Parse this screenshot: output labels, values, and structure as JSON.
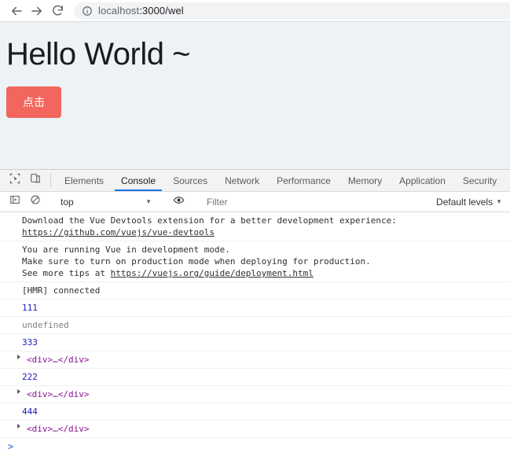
{
  "browser": {
    "back_icon": "arrow-left-icon",
    "forward_icon": "arrow-right-icon",
    "reload_icon": "reload-icon",
    "info_icon": "info-circle-icon",
    "url_host": "localhost",
    "url_rest": ":3000/wel",
    "url_full": "localhost:3000/wel"
  },
  "page": {
    "title": "Hello World ~",
    "button_label": "点击",
    "button_color": "#f3665e",
    "background_color": "#ecf2f6"
  },
  "devtools": {
    "toolbar_icons": [
      {
        "name": "inspect-element-icon"
      },
      {
        "name": "device-toolbar-icon"
      }
    ],
    "tabs": [
      {
        "label": "Elements",
        "active": false
      },
      {
        "label": "Console",
        "active": true
      },
      {
        "label": "Sources",
        "active": false
      },
      {
        "label": "Network",
        "active": false
      },
      {
        "label": "Performance",
        "active": false
      },
      {
        "label": "Memory",
        "active": false
      },
      {
        "label": "Application",
        "active": false
      },
      {
        "label": "Security",
        "active": false
      }
    ],
    "active_tab_underline_color": "#1a73e8",
    "console_toolbar": {
      "sidebar_toggle_icon": "console-sidebar-icon",
      "clear_icon": "clear-console-icon",
      "context_value": "top",
      "eye_icon": "live-expression-eye-icon",
      "filter_placeholder": "Filter",
      "levels_label": "Default levels",
      "caret": "▼"
    },
    "messages": [
      {
        "type": "text",
        "lines": [
          "Download the Vue Devtools extension for a better development experience:",
          "https://github.com/vuejs/vue-devtools"
        ],
        "link_line_index": 1
      },
      {
        "type": "text",
        "lines": [
          "You are running Vue in development mode.",
          "Make sure to turn on production mode when deploying for production.",
          "See more tips at https://vuejs.org/guide/deployment.html"
        ],
        "link_in_line": "https://vuejs.org/guide/deployment.html"
      },
      {
        "type": "text",
        "text": "[HMR] connected"
      },
      {
        "type": "number",
        "text": "111"
      },
      {
        "type": "undefined",
        "text": "undefined"
      },
      {
        "type": "number",
        "text": "333"
      },
      {
        "type": "node",
        "text": "<div>…</div>"
      },
      {
        "type": "number",
        "text": "222"
      },
      {
        "type": "node",
        "text": "<div>…</div>"
      },
      {
        "type": "number",
        "text": "444"
      },
      {
        "type": "node",
        "text": "<div>…</div>"
      }
    ],
    "prompt_caret": ">"
  }
}
